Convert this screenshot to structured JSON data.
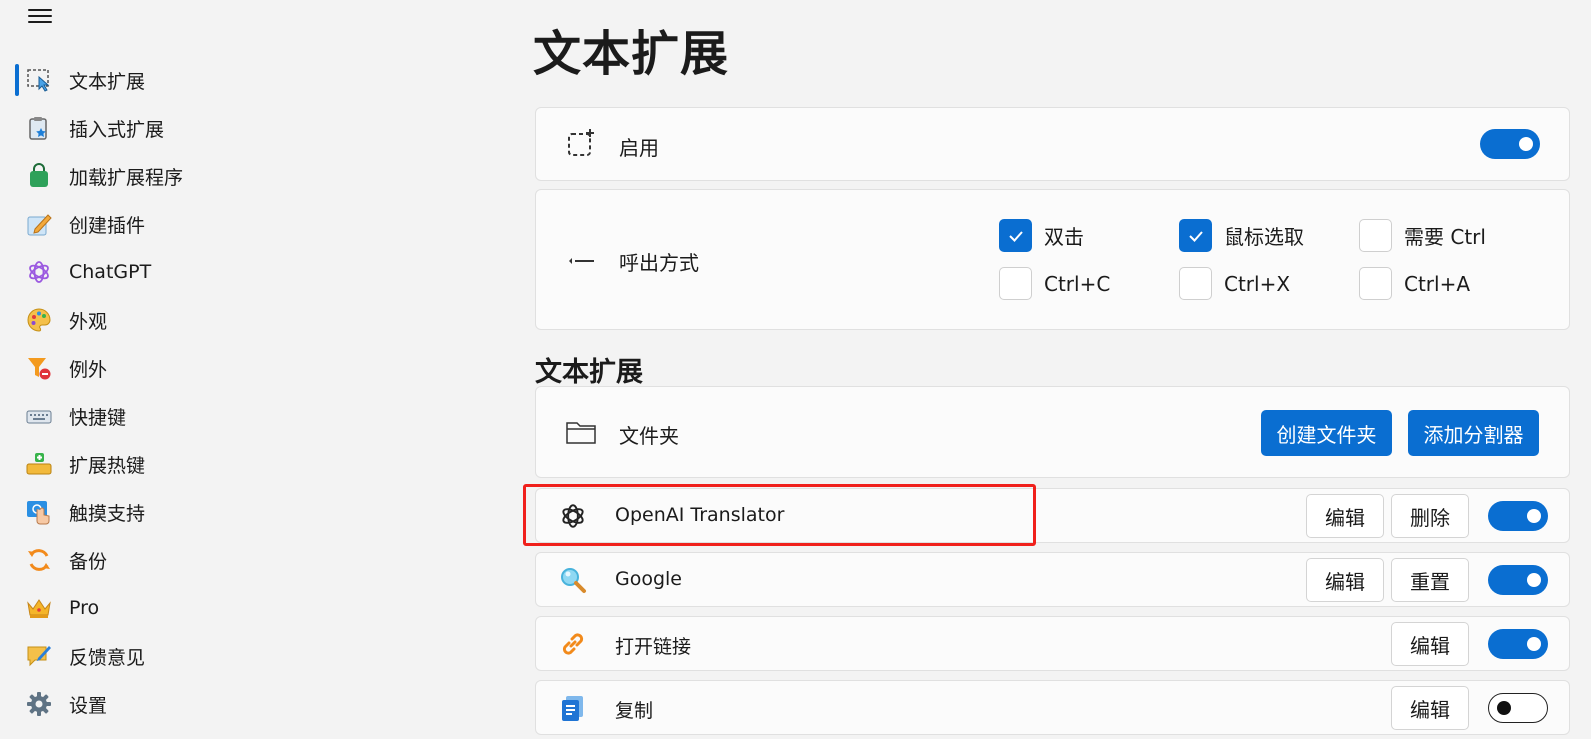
{
  "sidebar": {
    "menu_icon": "hamburger-menu-icon",
    "items": [
      {
        "label": "文本扩展",
        "icon": "text-select-icon",
        "active": true
      },
      {
        "label": "插入式扩展",
        "icon": "clipboard-star-icon"
      },
      {
        "label": "加载扩展程序",
        "icon": "shopping-bag-icon"
      },
      {
        "label": "创建插件",
        "icon": "pencil-edit-icon"
      },
      {
        "label": "ChatGPT",
        "icon": "openai-icon"
      },
      {
        "label": "外观",
        "icon": "palette-icon"
      },
      {
        "label": "例外",
        "icon": "filter-minus-icon"
      },
      {
        "label": "快捷键",
        "icon": "keyboard-icon"
      },
      {
        "label": "扩展热键",
        "icon": "hotkey-add-icon"
      },
      {
        "label": "触摸支持",
        "icon": "touch-icon"
      },
      {
        "label": "备份",
        "icon": "sync-icon"
      },
      {
        "label": "Pro",
        "icon": "crown-icon"
      },
      {
        "label": "反馈意见",
        "icon": "feedback-icon"
      },
      {
        "label": "设置",
        "icon": "gear-icon"
      }
    ]
  },
  "main": {
    "title": "文本扩展",
    "enable": {
      "label": "启用",
      "on": true
    },
    "trigger": {
      "label": "呼出方式",
      "options": [
        {
          "label": "双击",
          "checked": true
        },
        {
          "label": "鼠标选取",
          "checked": true
        },
        {
          "label": "需要 Ctrl",
          "checked": false
        },
        {
          "label": "Ctrl+C",
          "checked": false
        },
        {
          "label": "Ctrl+X",
          "checked": false
        },
        {
          "label": "Ctrl+A",
          "checked": false
        }
      ]
    },
    "section_title": "文本扩展",
    "folder": {
      "label": "文件夹",
      "create_folder": "创建文件夹",
      "add_separator": "添加分割器"
    },
    "extensions": [
      {
        "name": "OpenAI Translator",
        "icon": "openai-icon",
        "buttons": [
          "编辑",
          "删除"
        ],
        "enabled": true
      },
      {
        "name": "Google",
        "icon": "magnifier-icon",
        "buttons": [
          "编辑",
          "重置"
        ],
        "enabled": true
      },
      {
        "name": "打开链接",
        "icon": "link-icon",
        "buttons": [
          "编辑"
        ],
        "enabled": true
      },
      {
        "name": "复制",
        "icon": "copy-icon",
        "buttons": [
          "编辑"
        ],
        "enabled": false
      }
    ]
  },
  "colors": {
    "accent": "#0a6ed1",
    "highlight": "#f0201b",
    "background": "#f3f3f3"
  }
}
